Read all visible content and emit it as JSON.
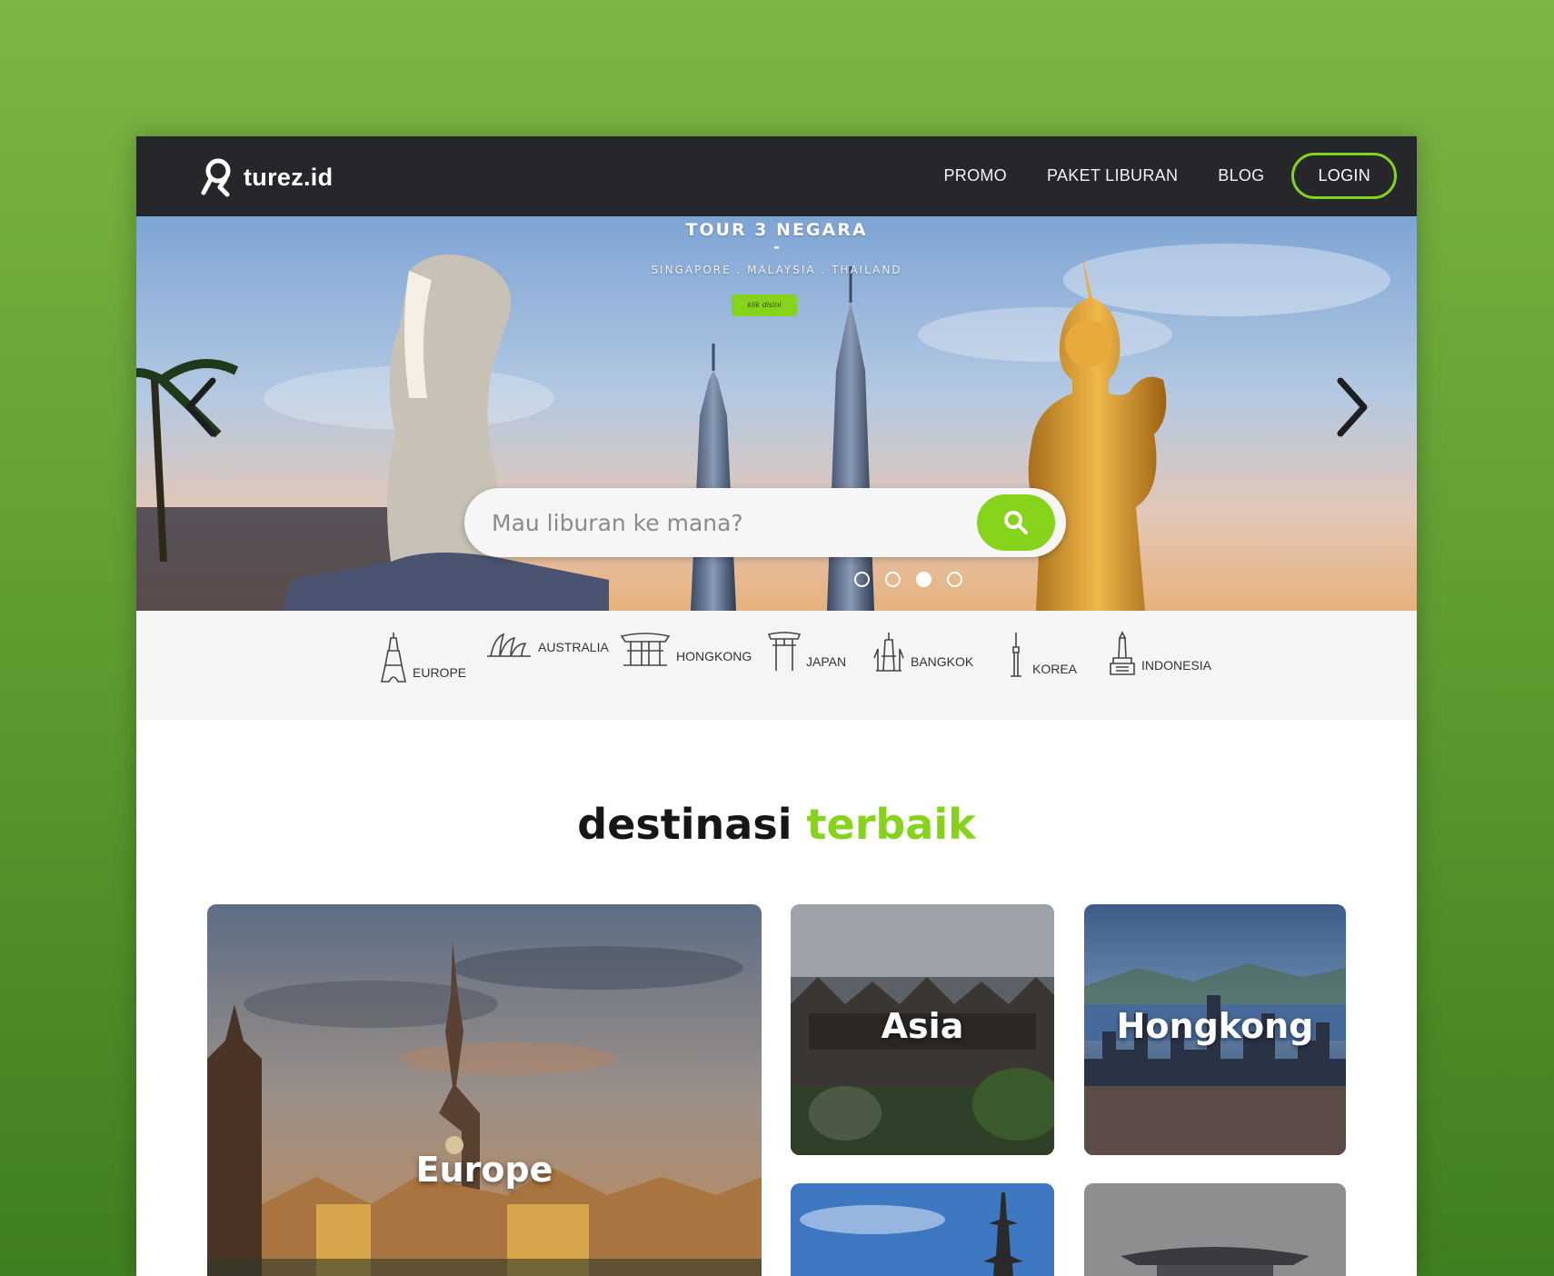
{
  "brand": {
    "name": "turez.id",
    "accent": "#86d31c",
    "nav_bg": "#25272b"
  },
  "nav": {
    "items": [
      {
        "label": "PROMO"
      },
      {
        "label": "PAKET LIBURAN"
      },
      {
        "label": "BLOG"
      }
    ],
    "login_label": "LOGIN"
  },
  "hero": {
    "title": "TOUR 3 NEGARA",
    "dash": "-",
    "subtitle": "SINGAPORE . MALAYSIA . THAILAND",
    "badge": "klik disini",
    "search_placeholder": "Mau liburan ke mana?",
    "search_icon": "search-icon",
    "slides_count": 4,
    "active_slide": 3
  },
  "categories": [
    {
      "label": "EUROPE",
      "icon": "eiffel-tower-icon"
    },
    {
      "label": "AUSTRALIA",
      "icon": "opera-house-icon"
    },
    {
      "label": "HONGKONG",
      "icon": "gate-icon"
    },
    {
      "label": "JAPAN",
      "icon": "torii-icon"
    },
    {
      "label": "BANGKOK",
      "icon": "temple-icon"
    },
    {
      "label": "KOREA",
      "icon": "tower-icon"
    },
    {
      "label": "INDONESIA",
      "icon": "monument-icon"
    }
  ],
  "section": {
    "title_part1": "destinasi",
    "title_part2": "terbaik"
  },
  "destinations": [
    {
      "label": "Europe"
    },
    {
      "label": "Asia"
    },
    {
      "label": "Hongkong"
    }
  ]
}
